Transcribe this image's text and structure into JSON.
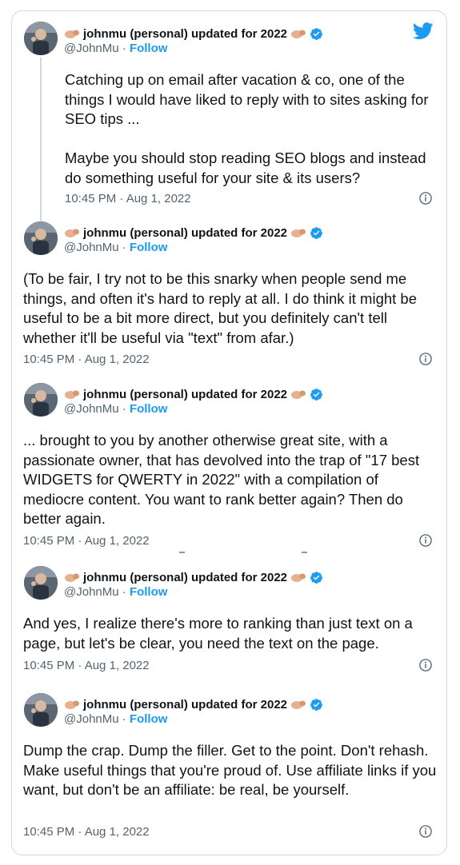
{
  "author": {
    "display_name": "johnmu (personal) updated for 2022",
    "handle": "@JohnMu",
    "separator": "·",
    "follow_label": "Follow"
  },
  "colors": {
    "accent": "#1d9bf0",
    "text": "#0f1419",
    "muted": "#536471",
    "border": "#cfd9de"
  },
  "icons": {
    "brand": "twitter-bird-icon",
    "verified": "verified-badge-icon",
    "info": "info-icon",
    "emoji": "flexed-biceps-emoji"
  },
  "tweets": [
    {
      "text": "Catching up on email after vacation & co, one of the things I would have liked to reply with to sites asking for SEO tips ...\n\nMaybe you should stop reading SEO blogs and instead do something useful for your site & its users?",
      "timestamp": "10:45 PM · Aug 1, 2022"
    },
    {
      "text": "(To be fair, I try not to be this snarky when people send me things, and often it's hard to reply at all. I do think it might be useful to be a bit more direct, but you definitely can't tell whether it'll be useful via \"text\" from afar.)",
      "timestamp": "10:45 PM · Aug 1, 2022"
    },
    {
      "text": "... brought to you by another otherwise great site, with a passionate owner, that has devolved into the trap of \"17 best WIDGETS for QWERTY in 2022\" with a compilation of mediocre content. You want to rank better again? Then do better again.",
      "timestamp": "10:45 PM · Aug 1, 2022"
    },
    {
      "text": "And yes, I realize there's more to ranking than just text on a page, but let's be clear, you need the text on the page.",
      "timestamp": "10:45 PM · Aug 1, 2022"
    },
    {
      "text": "Dump the crap. Dump the filler. Get to the point. Don't rehash. Make useful things that you're proud of. Use affiliate links if you want, but don't be an affiliate: be real, be yourself.",
      "timestamp": "10:45 PM · Aug 1, 2022"
    }
  ]
}
